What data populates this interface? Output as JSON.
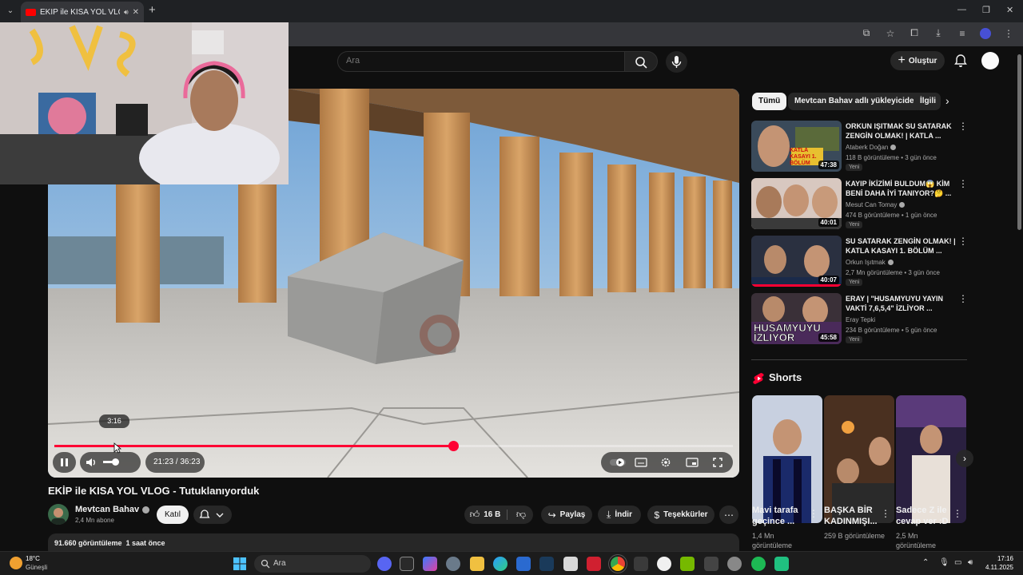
{
  "browser": {
    "tab_title": "EKİP ile KISA YOL VLOG - Tu",
    "new_tab_icon": "+",
    "audio_icon": "speaker-icon"
  },
  "header": {
    "search_placeholder": "Ara",
    "create_label": "Oluştur"
  },
  "player": {
    "hover_time": "3:16",
    "time_display": "21:23 / 36:23",
    "progress_fraction": 0.588,
    "hover_fraction": 0.09
  },
  "video": {
    "title": "EKİP ile KISA YOL VLOG - Tutuklanıyorduk",
    "channel": "Mevtcan Bahav",
    "subscribers": "2,4 Mn abone",
    "join_label": "Katıl",
    "likes": "16 B",
    "share_label": "Paylaş",
    "download_label": "İndir",
    "thanks_label": "Teşekkürler",
    "stats": "91.660 görüntüleme  1 saat önce"
  },
  "chips": [
    "Tümü",
    "Mevtcan Bahav adlı yükleyiciden",
    "İlgili"
  ],
  "recommendations": [
    {
      "title": "ORKUN IŞITMAK SU SATARAK ZENGİN OLMAK! | KATLA ...",
      "channel": "Ataberk Doğan",
      "meta": "118 B görüntüleme • 3 gün önce",
      "badge": "Yeni",
      "duration": "47:38",
      "thumb_text": "KATLA KASAYI 1. BÖLÜM"
    },
    {
      "title": "KAYIP İKİZİMİ BULDUM😱 KİM BENİ DAHA İYİ TANIYOR?🤔 ...",
      "channel": "Mesut Can Tomay",
      "meta": "474 B görüntüleme • 1 gün önce",
      "badge": "Yeni",
      "duration": "40:01",
      "thumb_text": ""
    },
    {
      "title": "SU SATARAK ZENGİN OLMAK! | KATLA KASAYI 1. BÖLÜM ...",
      "channel": "Orkun Işıtmak",
      "meta": "2,7 Mn görüntüleme • 3 gün önce",
      "badge": "Yeni",
      "duration": "40:07",
      "thumb_text": ""
    },
    {
      "title": "ERAY | \"HUSAMYUYU YAYIN VAKTİ 7,6,5,4\" İZLİYOR ...",
      "channel": "Eray Tepki",
      "meta": "234 B görüntüleme • 5 gün önce",
      "badge": "Yeni",
      "duration": "45:58",
      "thumb_text": "HUSAMYUYU İZLIYOR"
    }
  ],
  "shorts": {
    "heading": "Shorts",
    "items": [
      {
        "title": "Mavi tarafa geçince ...",
        "views": "1,4 Mn görüntüleme"
      },
      {
        "title": "BAŞKA BİR KADINMIŞI...",
        "views": "259 B görüntüleme"
      },
      {
        "title": "Sadece Z ile cevap ver :D",
        "views": "2,5 Mn görüntüleme"
      }
    ]
  },
  "taskbar": {
    "temperature": "18°C",
    "condition": "Güneşli",
    "search_label": "Ara",
    "time": "17:16",
    "date": "4.11.2025"
  },
  "colors": {
    "yt_red": "#ff0033",
    "background": "#0f0f0f",
    "chip_bg": "#272727"
  }
}
